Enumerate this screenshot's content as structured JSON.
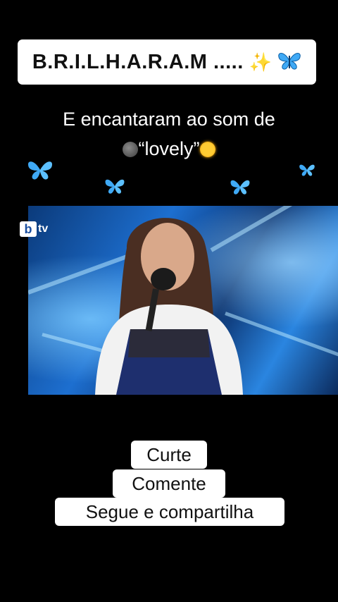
{
  "title": {
    "text": "B.R.I.L.H.A.R.A.M .....",
    "sparkle_icon": "sparkles-icon",
    "butterfly_icon": "butterfly-icon"
  },
  "subtitle": {
    "line1": "E encantaram ao som de",
    "line2": "“lovely”",
    "moon_icon": "new-moon-face-icon",
    "sun_icon": "sun-face-icon"
  },
  "video": {
    "channel_logo_b": "b",
    "channel_logo_tv": "tv"
  },
  "cta": {
    "line1": "Curte",
    "line2": "Comente",
    "line3": "Segue e compartilha"
  },
  "colors": {
    "background": "#000000",
    "butterfly": "#3fa9f5",
    "label_bg": "#ffffff"
  }
}
